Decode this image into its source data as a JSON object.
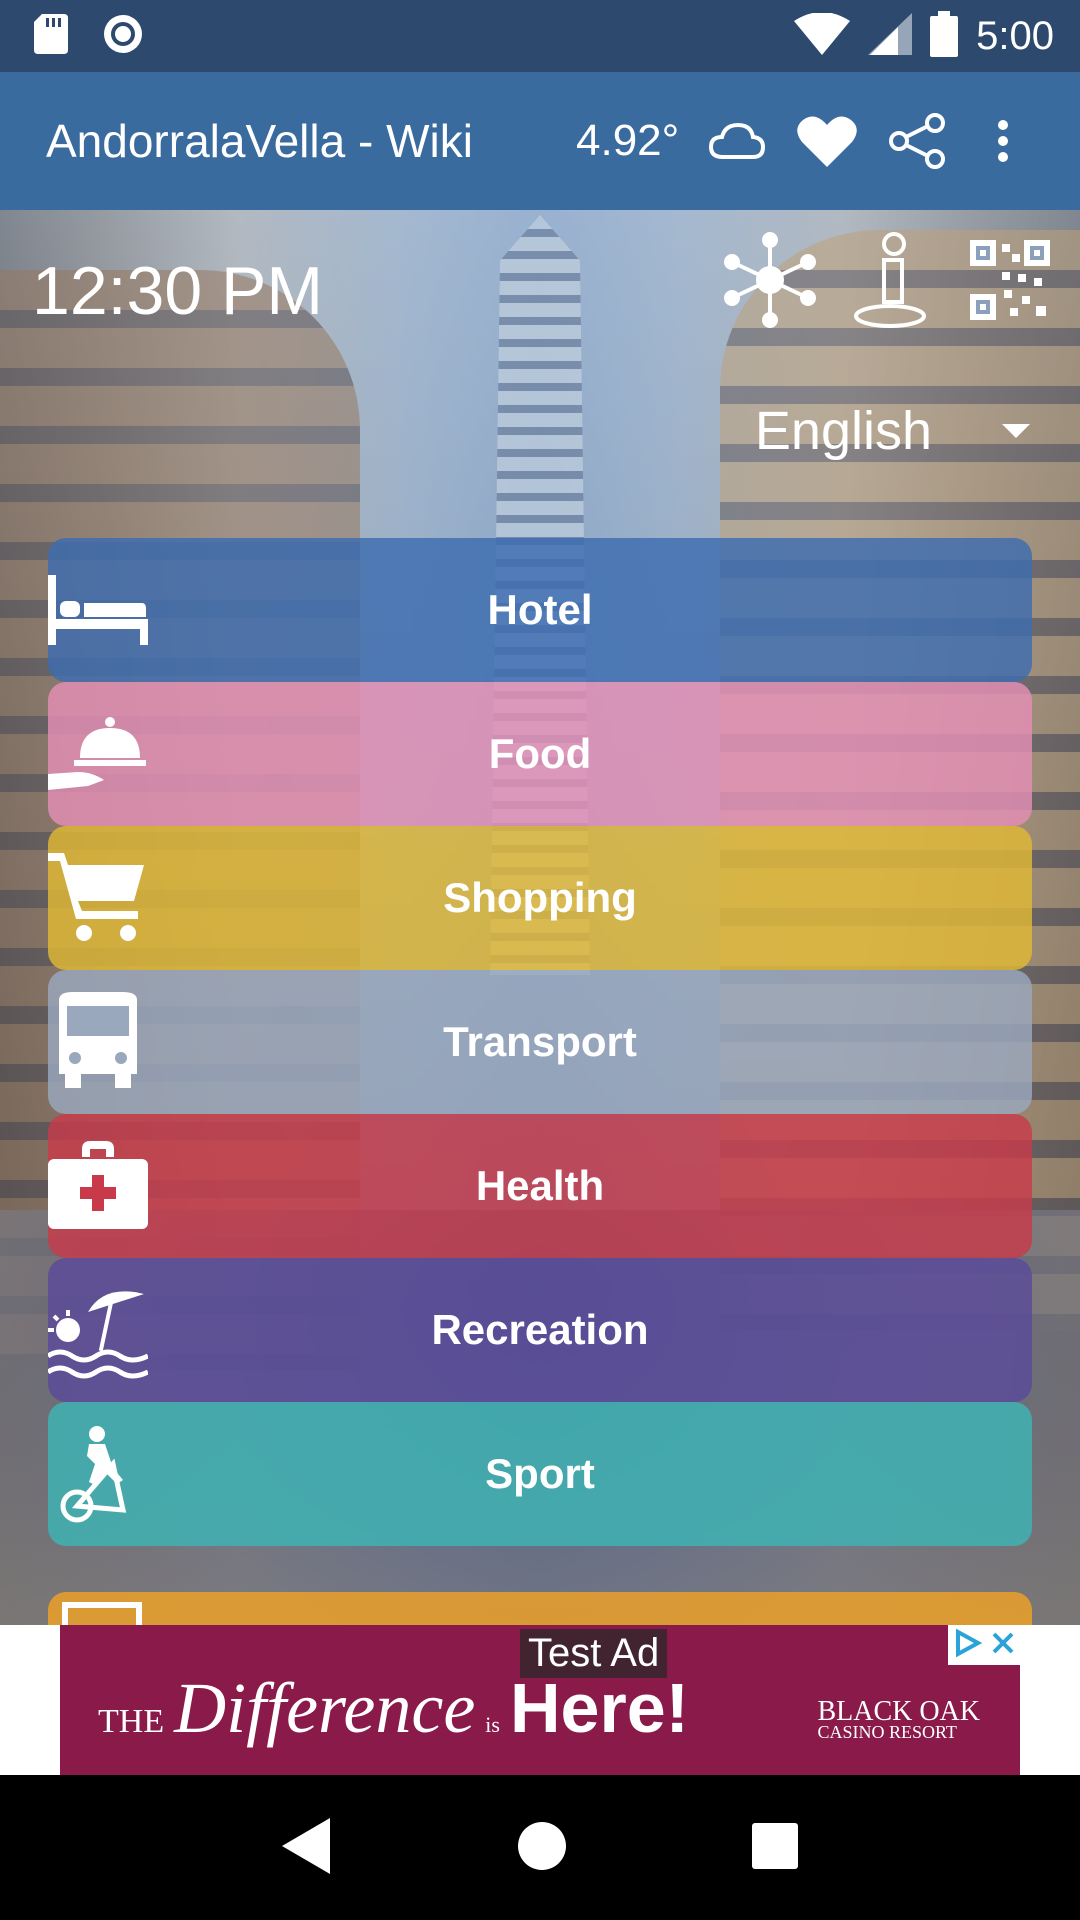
{
  "status_bar": {
    "time": "5:00",
    "icons": [
      "sd-card-icon",
      "circle-record-icon",
      "wifi-icon",
      "cell-signal-icon",
      "battery-icon"
    ]
  },
  "app_bar": {
    "title": "AndorralaVella - Wiki",
    "temperature": "4.92°",
    "icons": [
      "cloud-icon",
      "heart-icon",
      "share-icon",
      "more-vert-icon"
    ]
  },
  "main": {
    "clock": "12:30 PM",
    "top_icons": [
      "network-icon",
      "info-person-icon",
      "qr-code-icon"
    ],
    "language": {
      "selected": "English"
    },
    "menu": [
      {
        "label": "Hotel",
        "icon": "bed-icon",
        "color": "#3d6db0"
      },
      {
        "label": "Food",
        "icon": "food-tray-icon",
        "color": "#e48fb5"
      },
      {
        "label": "Shopping",
        "icon": "cart-icon",
        "color": "#e0b835"
      },
      {
        "label": "Transport",
        "icon": "bus-icon",
        "color": "#9aa8be"
      },
      {
        "label": "Health",
        "icon": "medical-kit-icon",
        "color": "#c83a4a"
      },
      {
        "label": "Recreation",
        "icon": "beach-icon",
        "color": "#5a4a9a"
      },
      {
        "label": "Sport",
        "icon": "exercise-icon",
        "color": "#3db5b5"
      }
    ]
  },
  "ad": {
    "label": "Test Ad",
    "text_the": "THE",
    "text_difference": "Difference",
    "text_is": "is",
    "text_here": "Here!",
    "brand_line1": "BLACK OAK",
    "brand_line2": "CASINO RESORT"
  },
  "nav_bar": {
    "icons": [
      "back-icon",
      "home-icon",
      "recents-icon"
    ]
  }
}
